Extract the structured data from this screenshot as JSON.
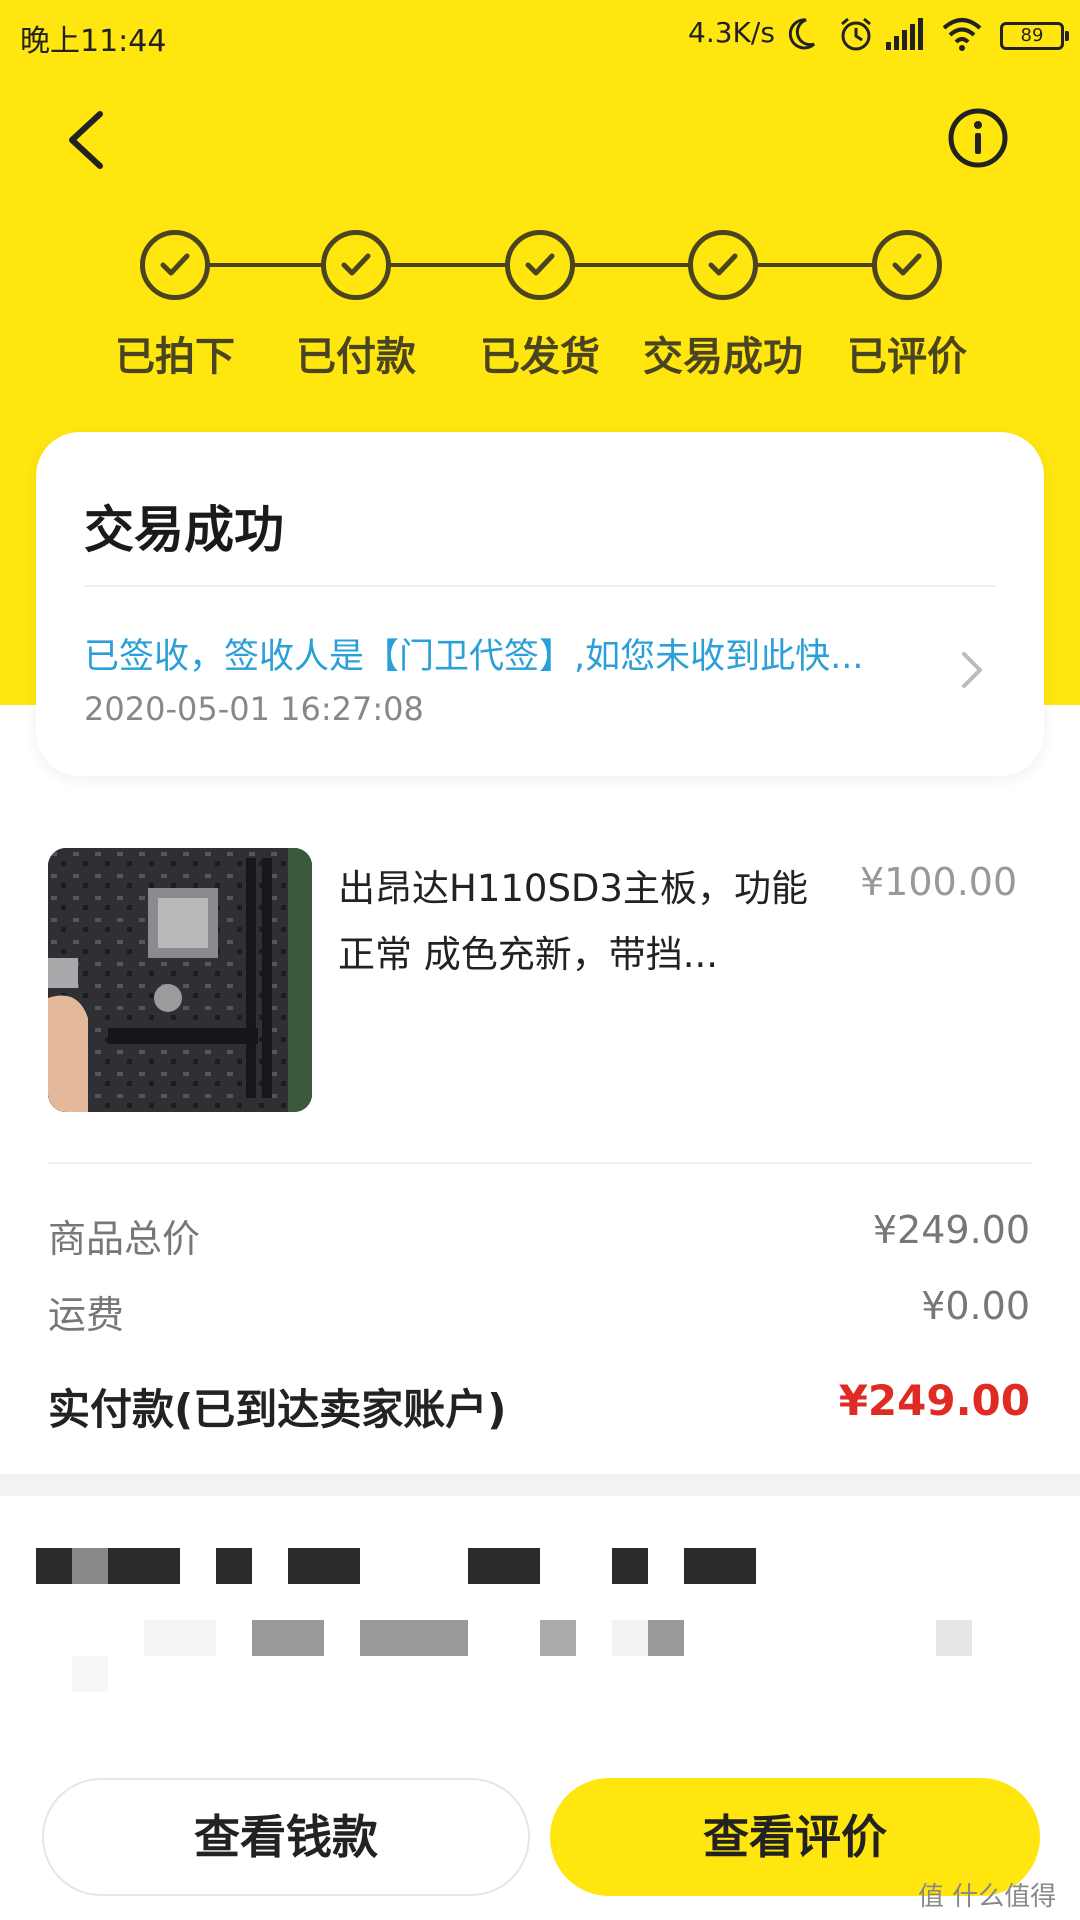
{
  "status_bar": {
    "time": "晚上11:44",
    "net_speed": "4.3K/s",
    "battery": "89"
  },
  "header": {
    "back_icon": "chevron-left-icon",
    "info_icon": "info-circle-icon"
  },
  "steps": [
    {
      "label": "已拍下",
      "done": true
    },
    {
      "label": "已付款",
      "done": true
    },
    {
      "label": "已发货",
      "done": true
    },
    {
      "label": "交易成功",
      "done": true
    },
    {
      "label": "已评价",
      "done": true
    }
  ],
  "status_card": {
    "title": "交易成功",
    "logistics_text": "已签收，签收人是【门卫代签】,如您未收到此快...",
    "logistics_time": "2020-05-01 16:27:08"
  },
  "product": {
    "title": "出昂达H110SD3主板，功能正常 成色充新，带挡...",
    "price": "¥100.00"
  },
  "summary": {
    "goods_total_label": "商品总价",
    "goods_total_value": "¥249.00",
    "shipping_label": "运费",
    "shipping_value": "¥0.00",
    "paid_label": "实付款(已到达卖家账户)",
    "paid_value": "¥249.00"
  },
  "actions": {
    "view_funds": "查看钱款",
    "view_review": "查看评价"
  },
  "watermark": "值 什么值得买",
  "colors": {
    "brand_yellow": "#ffe60f",
    "step_dark": "#4a4520",
    "link_blue": "#2a9fd8",
    "price_red": "#e02a24"
  }
}
